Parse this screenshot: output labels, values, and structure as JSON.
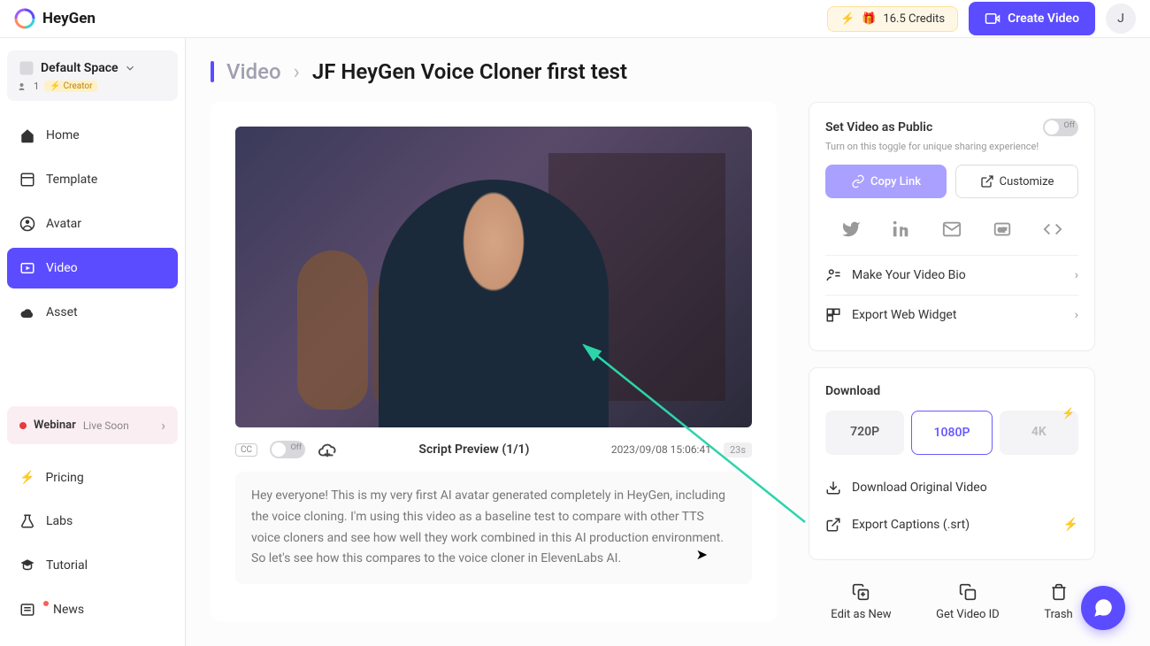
{
  "header": {
    "logo_text": "HeyGen",
    "credits": "16.5 Credits",
    "create_video": "Create Video",
    "avatar_initial": "J"
  },
  "sidebar": {
    "space_name": "Default Space",
    "member_count": "1",
    "role": "Creator",
    "nav": [
      {
        "label": "Home",
        "icon": "home"
      },
      {
        "label": "Template",
        "icon": "template"
      },
      {
        "label": "Avatar",
        "icon": "avatar"
      },
      {
        "label": "Video",
        "icon": "video"
      },
      {
        "label": "Asset",
        "icon": "asset"
      }
    ],
    "webinar_title": "Webinar",
    "webinar_sub": "Live Soon",
    "lower": [
      {
        "label": "Pricing",
        "icon": "pricing"
      },
      {
        "label": "Labs",
        "icon": "labs"
      },
      {
        "label": "Tutorial",
        "icon": "tutorial"
      },
      {
        "label": "News",
        "icon": "news"
      }
    ]
  },
  "breadcrumb": {
    "root": "Video",
    "title": "JF HeyGen Voice Cloner first test"
  },
  "video": {
    "script_preview": "Script Preview (1/1)",
    "timestamp": "2023/09/08 15:06:41",
    "duration": "23s",
    "toggle": "Off",
    "script_text": "Hey everyone! This is my very first AI avatar generated completely in HeyGen, including the voice cloning. I'm using this video as a baseline test to compare with other TTS voice cloners and see how well they work combined in this AI production environment. So let's see how this compares to the voice cloner in ElevenLabs AI."
  },
  "share": {
    "public_title": "Set Video as Public",
    "public_sub": "Turn on this toggle for unique sharing experience!",
    "public_toggle": "Off",
    "copy_link": "Copy Link",
    "customize": "Customize",
    "video_bio": "Make Your Video Bio",
    "web_widget": "Export Web Widget"
  },
  "download": {
    "title": "Download",
    "res": [
      "720P",
      "1080P",
      "4K"
    ],
    "original": "Download Original Video",
    "captions": "Export Captions (.srt)"
  },
  "actions": {
    "edit": "Edit as New",
    "get_id": "Get Video ID",
    "trash": "Trash"
  }
}
